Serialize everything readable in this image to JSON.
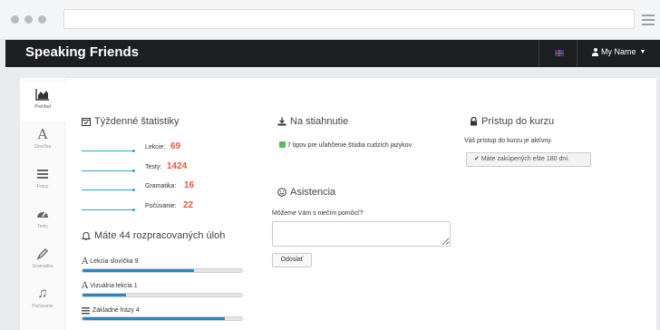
{
  "app": {
    "brand": "Speaking Friends",
    "language_flag": "uk-flag-icon",
    "user_menu_label": "My Name"
  },
  "sidebar": {
    "items": [
      {
        "label": "Prehľad",
        "icon": "overview-chart-icon"
      },
      {
        "label": "Slovíčka",
        "icon": "letter-a-icon"
      },
      {
        "label": "Frázy",
        "icon": "phrases-icon"
      },
      {
        "label": "Testy",
        "icon": "gauge-icon"
      },
      {
        "label": "Gramatika",
        "icon": "pencil-icon"
      },
      {
        "label": "Počúvanie",
        "icon": "music-note-icon"
      }
    ]
  },
  "weekly_stats": {
    "title": "Týždenné štatistiky",
    "rows": [
      {
        "label": "Lekcie:",
        "value": "69"
      },
      {
        "label": "Testy:",
        "value": "1424"
      },
      {
        "label": "Gramatika:",
        "value": "16"
      },
      {
        "label": "Počúvanie:",
        "value": "22"
      }
    ]
  },
  "tasks": {
    "title": "Máte 44 rozpracovaných úloh",
    "items": [
      {
        "name": "Lekcia slovíčka 9",
        "progress": 0.7
      },
      {
        "name": "Vizuálna lekcia 1",
        "progress": 0.27
      },
      {
        "name": "Základné frázy 4",
        "progress": 0.89
      }
    ]
  },
  "downloads": {
    "title": "Na stiahnutie",
    "link": "7 tipov pre uľahčenie štúdia cudzích jazykov"
  },
  "assistance": {
    "title": "Asistencia",
    "question": "Môžeme Vám s niečím pomôcť?",
    "textarea_value": "",
    "submit_label": "Odoslať"
  },
  "access": {
    "title": "Prístup do kurzu",
    "status": "Váš prístup do kurzu je aktívny.",
    "days_button": "Máte zakúpených ešte 180 dní."
  },
  "colors": {
    "accent_orange": "#e8573a",
    "progress_blue": "#2a86c6",
    "navbar": "#1d1e20"
  }
}
